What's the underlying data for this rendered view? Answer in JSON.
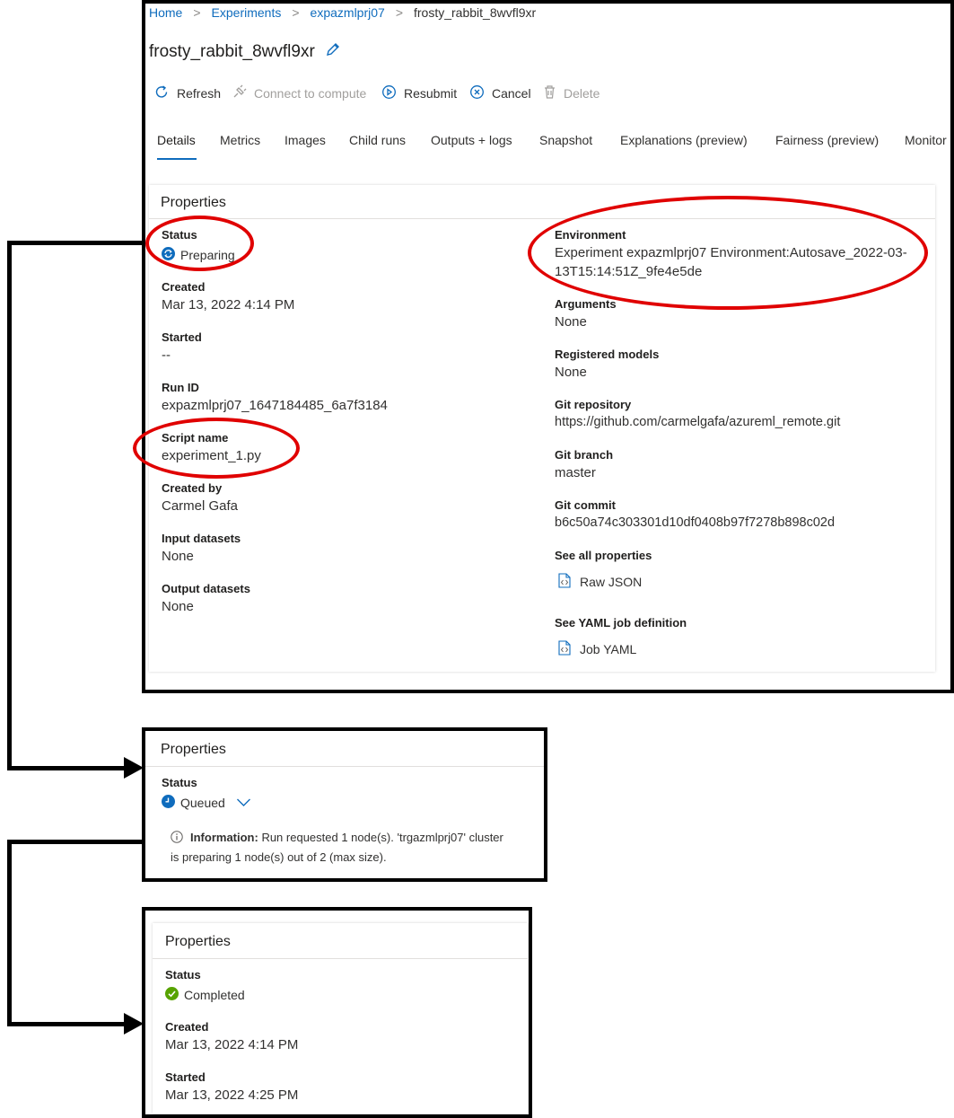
{
  "breadcrumb": {
    "items": [
      "Home",
      "Experiments",
      "expazmlprj07",
      "frosty_rabbit_8wvfl9xr"
    ],
    "separator": ">"
  },
  "page": {
    "title": "frosty_rabbit_8wvfl9xr",
    "edit_icon": "pencil-icon"
  },
  "toolbar": {
    "refresh": "Refresh",
    "connect": "Connect to compute",
    "resubmit": "Resubmit",
    "cancel": "Cancel",
    "delete": "Delete"
  },
  "tabs": [
    "Details",
    "Metrics",
    "Images",
    "Child runs",
    "Outputs + logs",
    "Snapshot",
    "Explanations (preview)",
    "Fairness (preview)",
    "Monitor"
  ],
  "properties": {
    "heading": "Properties",
    "left": {
      "status_label": "Status",
      "status_value": "Preparing",
      "created_label": "Created",
      "created_value": "Mar 13, 2022 4:14 PM",
      "started_label": "Started",
      "started_value": "--",
      "runid_label": "Run ID",
      "runid_value": "expazmlprj07_1647184485_6a7f3184",
      "script_label": "Script name",
      "script_value": "experiment_1.py",
      "createdby_label": "Created by",
      "createdby_value": "Carmel Gafa",
      "input_label": "Input datasets",
      "input_value": "None",
      "output_label": "Output datasets",
      "output_value": "None"
    },
    "right": {
      "env_label": "Environment",
      "env_value_line1": "Experiment expazmlprj07 Environment:Autosave_2022-03-",
      "env_value_line2": "13T15:14:51Z_9fe4e5de",
      "args_label": "Arguments",
      "args_value": "None",
      "models_label": "Registered models",
      "models_value": "None",
      "gitrepo_label": "Git repository",
      "gitrepo_value": "https://github.com/carmelgafa/azureml_remote.git",
      "gitbranch_label": "Git branch",
      "gitbranch_value": "master",
      "gitcommit_label": "Git commit",
      "gitcommit_value": "b6c50a74c303301d10df0408b97f7278b898c02d",
      "seeall_label": "See all properties",
      "rawjson": "Raw JSON",
      "yaml_label": "See YAML job definition",
      "jobyaml": "Job YAML"
    }
  },
  "queued_panel": {
    "heading": "Properties",
    "status_label": "Status",
    "status_value": "Queued",
    "info_bold": "Information:",
    "info_line1": " Run requested 1 node(s). 'trgazmlprj07' cluster",
    "info_line2": "is preparing 1 node(s) out of 2 (max size)."
  },
  "completed_panel": {
    "heading": "Properties",
    "status_label": "Status",
    "status_value": "Completed",
    "created_label": "Created",
    "created_value": "Mar 13, 2022 4:14 PM",
    "started_label": "Started",
    "started_value": "Mar 13, 2022 4:25 PM"
  },
  "colors": {
    "accent": "#0f6cbd",
    "annotation_red": "#e00000",
    "success_green": "#57a300",
    "frame_black": "#000000"
  }
}
